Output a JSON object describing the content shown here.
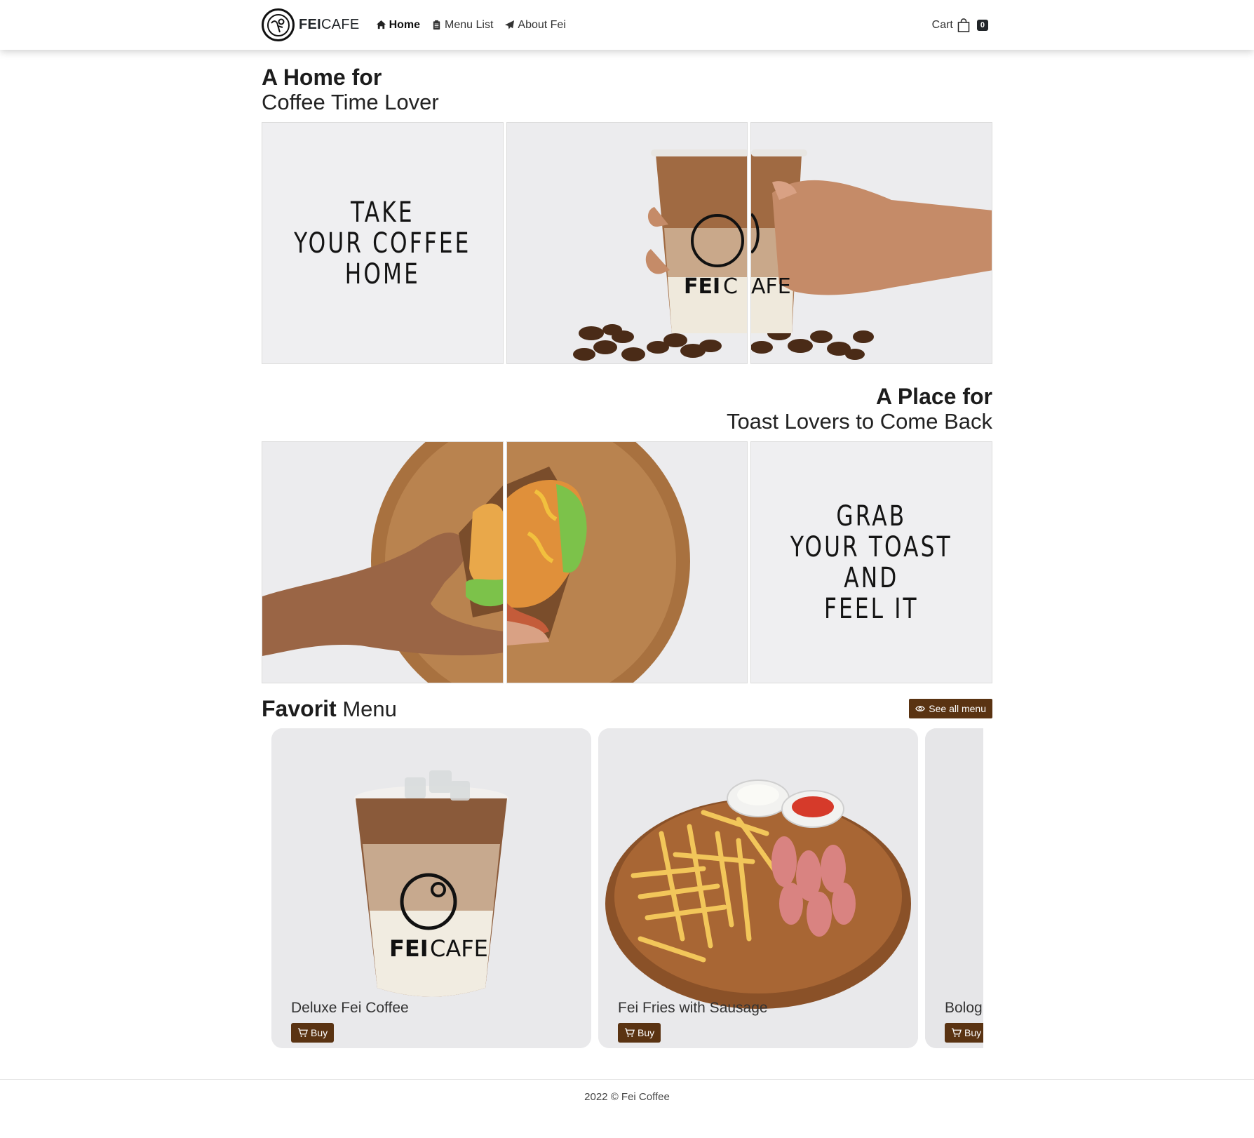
{
  "nav": {
    "brand_bold": "FEI",
    "brand_light": "CAFE",
    "links": [
      {
        "label": "Home",
        "icon": "home-icon"
      },
      {
        "label": "Menu List",
        "icon": "clipboard-icon"
      },
      {
        "label": "About Fei",
        "icon": "paper-plane-icon"
      }
    ],
    "cart_label": "Cart",
    "cart_count": "0"
  },
  "hero1": {
    "title_bold": "A Home for",
    "title_light": "Coffee Time Lover",
    "tile_text": [
      "TAKE",
      "YOUR COFFEE",
      "HOME"
    ],
    "cup_brand_bold": "FEI",
    "cup_brand_light": "CAFE"
  },
  "hero2": {
    "title_bold": "A Place for",
    "title_light": "Toast Lovers to Come Back",
    "tile_text": [
      "GRAB",
      "YOUR TOAST",
      "AND",
      "FEEL IT"
    ]
  },
  "favorites": {
    "title_bold": "Favorit",
    "title_light": "Menu",
    "see_all_label": "See all menu",
    "items": [
      {
        "name": "Deluxe Fei Coffee",
        "buy_label": "Buy"
      },
      {
        "name": "Fei Fries with Sausage",
        "buy_label": "Buy"
      },
      {
        "name": "Bolog",
        "buy_label": "Buy"
      }
    ]
  },
  "footer": {
    "text": "2022 © Fei Coffee"
  },
  "colors": {
    "accent": "#5a3312",
    "badge": "#212529",
    "tile_bg": "#efeff1"
  }
}
